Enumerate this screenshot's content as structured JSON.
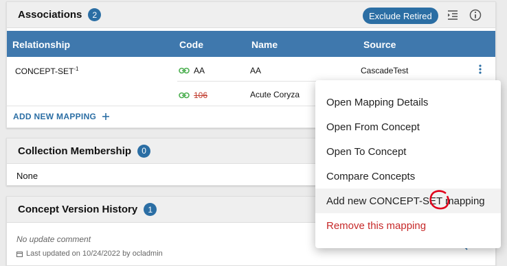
{
  "associations": {
    "title": "Associations",
    "count": "2",
    "exclude_label": "Exclude Retired",
    "columns": [
      "Relationship",
      "Code",
      "Name",
      "Source"
    ],
    "relationship": "CONCEPT-SET",
    "relationship_sup": "-1",
    "rows": [
      {
        "code": "AA",
        "name": "AA",
        "source": "CascadeTest"
      },
      {
        "code": "106",
        "name": "Acute Coryza",
        "source": ""
      }
    ],
    "add_label": "ADD NEW MAPPING"
  },
  "collection": {
    "title": "Collection Membership",
    "count": "0",
    "none_text": "None"
  },
  "history": {
    "title": "Concept Version History",
    "count": "1",
    "comment": "No update comment",
    "last_updated": "Last updated on 10/24/2022 by ocladmin"
  },
  "menu": {
    "items": [
      "Open Mapping Details",
      "Open From Concept",
      "Open To Concept",
      "Compare Concepts",
      "Add new CONCEPT-SET mapping",
      "Remove this mapping"
    ]
  },
  "colors": {
    "accent": "#2b6ea4",
    "table_header": "#3f78ad",
    "link_icon": "#4caf50",
    "danger": "#c62828",
    "annotation": "#e0001b"
  },
  "icons": {
    "hierarchy": "indent-list-icon",
    "info": "info-icon",
    "more": "more-vert-icon",
    "link": "link-icon",
    "add": "plus-icon",
    "calendar": "calendar-icon",
    "search": "search-icon"
  }
}
